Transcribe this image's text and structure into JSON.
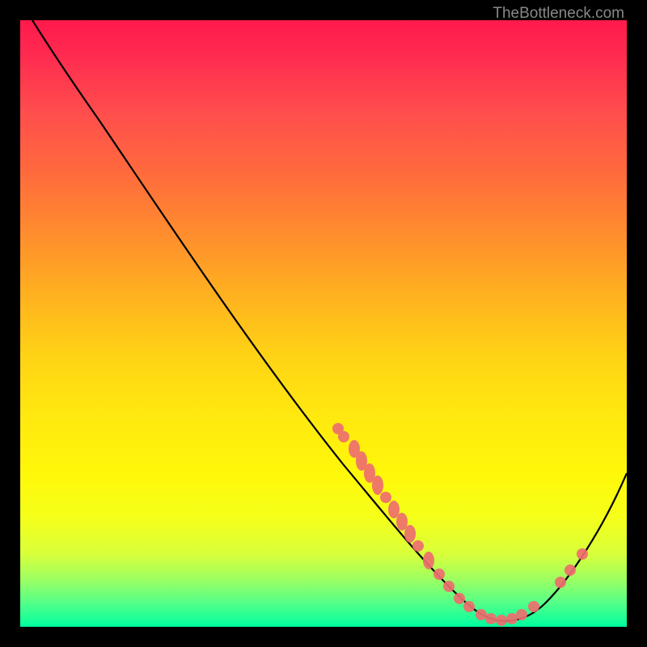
{
  "attribution": "TheBottleneck.com",
  "chart_data": {
    "type": "line",
    "title": "",
    "xlabel": "",
    "ylabel": "",
    "xlim": [
      0,
      100
    ],
    "ylim": [
      0,
      100
    ],
    "curve": [
      {
        "x": 2,
        "y": 100
      },
      {
        "x": 8,
        "y": 94
      },
      {
        "x": 15,
        "y": 85
      },
      {
        "x": 25,
        "y": 70
      },
      {
        "x": 35,
        "y": 55
      },
      {
        "x": 45,
        "y": 40
      },
      {
        "x": 55,
        "y": 25
      },
      {
        "x": 62,
        "y": 13
      },
      {
        "x": 68,
        "y": 6
      },
      {
        "x": 73,
        "y": 2
      },
      {
        "x": 78,
        "y": 1
      },
      {
        "x": 82,
        "y": 2
      },
      {
        "x": 87,
        "y": 7
      },
      {
        "x": 92,
        "y": 15
      },
      {
        "x": 97,
        "y": 25
      },
      {
        "x": 100,
        "y": 33
      }
    ],
    "markers": [
      {
        "x": 52,
        "y": 33
      },
      {
        "x": 53,
        "y": 31
      },
      {
        "x": 55,
        "y": 28
      },
      {
        "x": 56,
        "y": 26
      },
      {
        "x": 57,
        "y": 24
      },
      {
        "x": 58,
        "y": 22
      },
      {
        "x": 59,
        "y": 20
      },
      {
        "x": 60,
        "y": 18
      },
      {
        "x": 61,
        "y": 16
      },
      {
        "x": 62,
        "y": 14
      },
      {
        "x": 63,
        "y": 12
      },
      {
        "x": 64,
        "y": 10
      },
      {
        "x": 66,
        "y": 7
      },
      {
        "x": 68,
        "y": 5
      },
      {
        "x": 70,
        "y": 3
      },
      {
        "x": 72,
        "y": 2
      },
      {
        "x": 74,
        "y": 1.5
      },
      {
        "x": 76,
        "y": 1
      },
      {
        "x": 78,
        "y": 1
      },
      {
        "x": 80,
        "y": 1.5
      },
      {
        "x": 82,
        "y": 2.5
      },
      {
        "x": 84,
        "y": 4
      },
      {
        "x": 88,
        "y": 9
      },
      {
        "x": 90,
        "y": 12
      },
      {
        "x": 92,
        "y": 15
      }
    ],
    "marker_color": "#f07070",
    "curve_color": "#000000"
  }
}
